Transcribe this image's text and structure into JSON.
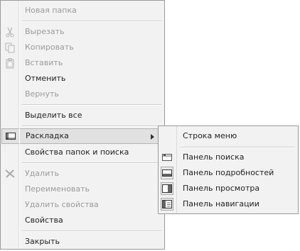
{
  "context_menu": {
    "new_folder": "Новая папка",
    "cut": "Вырезать",
    "copy": "Копировать",
    "paste": "Вставить",
    "undo": "Отменить",
    "redo": "Вернуть",
    "select_all": "Выделить все",
    "layout": "Раскладка",
    "folder_options": "Свойства папок и поиска",
    "delete": "Удалить",
    "rename": "Переименовать",
    "remove_properties": "Удалить свойства",
    "properties": "Свойства",
    "close": "Закрыть"
  },
  "layout_submenu": {
    "menu_bar": "Строка меню",
    "search_pane": "Панель поиска",
    "details_pane": "Панель подробностей",
    "preview_pane": "Панель просмотра",
    "navigation_pane": "Панель навигации"
  },
  "icons": {
    "cut": "scissors-icon",
    "copy": "copy-icon",
    "paste": "paste-icon",
    "layout": "layout-icon",
    "delete": "delete-x-icon"
  }
}
